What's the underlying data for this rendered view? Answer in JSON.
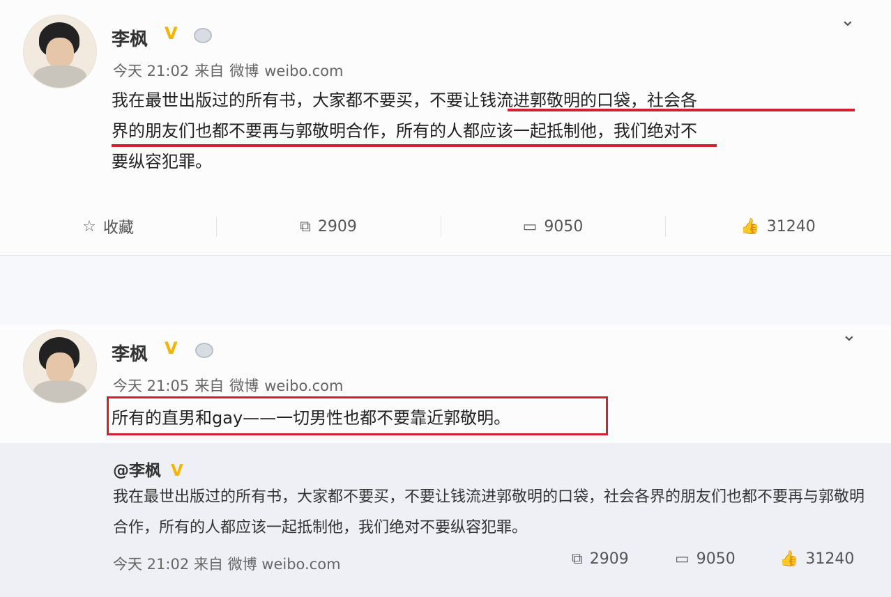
{
  "post1": {
    "username": "李枫",
    "v_badge": "V",
    "time": "今天 21:02",
    "via": "来自",
    "source_app": "微博",
    "source_url": "weibo.com",
    "text_line1_a": "我在最世出版过的所有书，大家都不要买，",
    "text_line1_b": "不要让钱流进郭敬明的口袋，社会各",
    "text_line2_a": "界的朋友们也都不要再与郭敬明合作，所有的人都应该一起抵制他",
    "text_line2_b": "，我们绝对不",
    "text_line3": "要纵容犯罪。",
    "actions": {
      "favorite_label": "收藏",
      "repost_count": "2909",
      "comment_count": "9050",
      "like_count": "31240"
    }
  },
  "post2": {
    "username": "李枫",
    "v_badge": "V",
    "time": "今天 21:05",
    "via": "来自",
    "source_app": "微博",
    "source_url": "weibo.com",
    "text": "所有的直男和gay——一切男性也都不要靠近郭敬明。",
    "repost": {
      "username": "@李枫",
      "v_badge": "V",
      "text": "我在最世出版过的所有书，大家都不要买，不要让钱流进郭敬明的口袋，社会各界的朋友们也都不要再与郭敬明合作，所有的人都应该一起抵制他，我们绝对不要纵容犯罪。",
      "time": "今天 21:02",
      "via": "来自",
      "source_app": "微博",
      "source_url": "weibo.com",
      "repost_count": "2909",
      "comment_count": "9050",
      "like_count": "31240"
    }
  },
  "icons": {
    "verified": "verified-v-icon",
    "crown": "crown-icon",
    "chevron": "chevron-down-icon",
    "star": "star-icon",
    "repost": "repost-icon",
    "comment": "comment-icon",
    "like": "thumbs-up-icon"
  },
  "colors": {
    "highlight": "#d61f2c",
    "verified": "#f5b400"
  }
}
